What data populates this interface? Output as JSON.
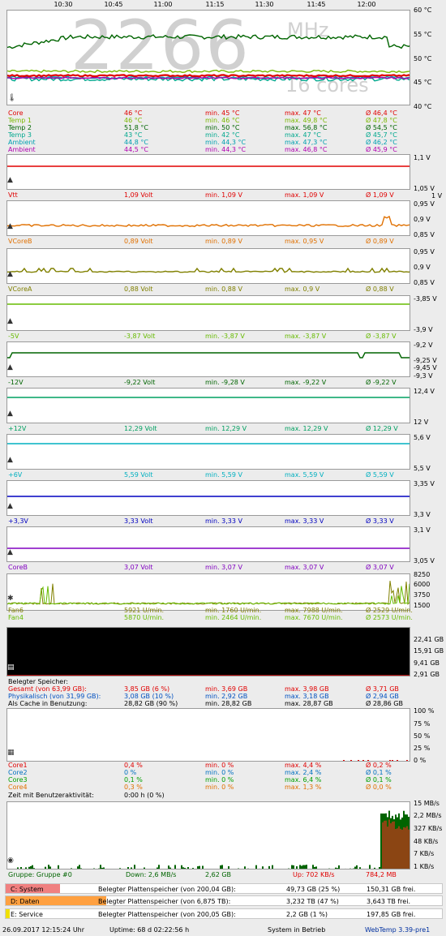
{
  "time_ticks": [
    "10:30",
    "10:45",
    "11:00",
    "11:15",
    "11:30",
    "11:45",
    "12:00"
  ],
  "temp": {
    "cpu_freq_value": "2266",
    "cpu_freq_unit": "MHz",
    "cores": "16 cores",
    "yaxis": [
      "60 °C",
      "55 °C",
      "50 °C",
      "45 °C",
      "40 °C"
    ],
    "rows": [
      {
        "name": "Core",
        "cur": "46 °C",
        "min": "min. 45 °C",
        "max": "max. 47 °C",
        "avg": "Ø 46,4 °C",
        "color": "#e00000"
      },
      {
        "name": "Temp 1",
        "cur": "46 °C",
        "min": "min. 46 °C",
        "max": "max. 49,8 °C",
        "avg": "Ø 47,8 °C",
        "color": "#7ab800"
      },
      {
        "name": "Temp 2",
        "cur": "51,8 °C",
        "min": "min. 50 °C",
        "max": "max. 56,8 °C",
        "avg": "Ø 54,5 °C",
        "color": "#006400"
      },
      {
        "name": "Temp 3",
        "cur": "43 °C",
        "min": "min. 42 °C",
        "max": "max. 47 °C",
        "avg": "Ø 45,7 °C",
        "color": "#00a88e"
      },
      {
        "name": "Ambient",
        "cur": "44,8 °C",
        "min": "min. 44,3 °C",
        "max": "max. 47,3 °C",
        "avg": "Ø 46,2 °C",
        "color": "#00a0b0"
      },
      {
        "name": "Ambient",
        "cur": "44,5 °C",
        "min": "min. 44,3 °C",
        "max": "max. 46,8 °C",
        "avg": "Ø 45,9 °C",
        "color": "#b000b0"
      }
    ]
  },
  "voltages": [
    {
      "name": "Vtt",
      "cur": "1,09 Volt",
      "min": "min. 1,09 V",
      "max": "max. 1,09 V",
      "avg": "Ø 1,09 V",
      "color": "#e00000",
      "ytop": "1,1 V",
      "ymid": "",
      "ybot": "1,05 V"
    },
    {
      "name": "VCoreB",
      "cur": "0,89 Volt",
      "min": "min. 0,89 V",
      "max": "max. 0,95 V",
      "avg": "Ø 0,89 V",
      "color": "#e07000",
      "ytop": "0,95 V",
      "ymid": "0,9 V",
      "ybot": "0,85 V",
      "ytop2": "1 V"
    },
    {
      "name": "VCoreA",
      "cur": "0,88 Volt",
      "min": "min. 0,88 V",
      "max": "max. 0,9 V",
      "avg": "Ø 0,88 V",
      "color": "#808000",
      "ytop": "0,95 V",
      "ymid": "0,9 V",
      "ybot": "0,85 V"
    },
    {
      "name": "-5V",
      "cur": "-3,87 Volt",
      "min": "min. -3,87 V",
      "max": "max. -3,87 V",
      "avg": "Ø -3,87 V",
      "color": "#66bb00",
      "ytop": "-3,85 V",
      "ymid": "",
      "ybot": "-3,9 V"
    },
    {
      "name": "-12V",
      "cur": "-9,22 Volt",
      "min": "min. -9,28 V",
      "max": "max. -9,22 V",
      "avg": "Ø -9,22 V",
      "color": "#006400",
      "ytop": "-9,2 V",
      "ymid": "-9,25 V",
      "ybot": "-9,3 V",
      "ytop0": "-9,45 V"
    },
    {
      "name": "+12V",
      "cur": "12,29 Volt",
      "min": "min. 12,29 V",
      "max": "max. 12,29 V",
      "avg": "Ø 12,29 V",
      "color": "#00a060",
      "ytop": "12,4 V",
      "ymid": "",
      "ybot": "12 V"
    },
    {
      "name": "+6V",
      "cur": "5,59 Volt",
      "min": "min. 5,59 V",
      "max": "max. 5,59 V",
      "avg": "Ø 5,59 V",
      "color": "#00b0c0",
      "ytop": "5,6 V",
      "ymid": "",
      "ybot": "5,5 V"
    },
    {
      "name": "+3,3V",
      "cur": "3,33 Volt",
      "min": "min. 3,33 V",
      "max": "max. 3,33 V",
      "avg": "Ø 3,33 V",
      "color": "#0000c0",
      "ytop": "3,35 V",
      "ymid": "",
      "ybot": "3,3 V"
    },
    {
      "name": "CoreB",
      "cur": "3,07 Volt",
      "min": "min. 3,07 V",
      "max": "max. 3,07 V",
      "avg": "Ø 3,07 V",
      "color": "#8000c0",
      "ytop": "3,1 V",
      "ymid": "",
      "ybot": "3,05 V"
    }
  ],
  "fans": {
    "yaxis": [
      "8250",
      "6000",
      "3750",
      "1500"
    ],
    "rows": [
      {
        "name": "Fan6",
        "cur": "5921 U/min.",
        "min": "min. 1760 U/min.",
        "max": "max. 7988 U/min.",
        "avg": "Ø 2529 U/min.",
        "color": "#808000"
      },
      {
        "name": "Fan4",
        "cur": "5870 U/min.",
        "min": "min. 2464 U/min.",
        "max": "max. 7670 U/min.",
        "avg": "Ø 2573 U/min.",
        "color": "#66bb00"
      }
    ]
  },
  "memory": {
    "yaxis": [
      "22,41 GB",
      "15,91 GB",
      "9,41 GB",
      "2,91 GB"
    ],
    "heading": "Belegter Speicher:",
    "rows": [
      {
        "name": "Gesamt (von 63,99 GB):",
        "cur": "3,85 GB (6 %)",
        "min": "min. 3,69 GB",
        "max": "max. 3,98 GB",
        "avg": "Ø 3,71 GB",
        "color": "#e00000"
      },
      {
        "name": "Physikalisch (von 31,99 GB):",
        "cur": "3,08 GB (10 %)",
        "min": "min. 2,92 GB",
        "max": "max. 3,18 GB",
        "avg": "Ø 2,94 GB",
        "color": "#0050c0"
      },
      {
        "name": "Als Cache in Benutzung:",
        "cur": "28,82 GB (90 %)",
        "min": "min. 28,82 GB",
        "max": "max. 28,87 GB",
        "avg": "Ø 28,86 GB",
        "color": "#000000"
      }
    ]
  },
  "cpu": {
    "yaxis": [
      "100 %",
      "75 %",
      "50 %",
      "25 %",
      "0 %"
    ],
    "rows": [
      {
        "name": "Core1",
        "cur": "0,4 %",
        "min": "min. 0 %",
        "max": "max. 4,4 %",
        "avg": "Ø 0,2 %",
        "color": "#e00000"
      },
      {
        "name": "Core2",
        "cur": "0 %",
        "min": "min. 0 %",
        "max": "max. 2,4 %",
        "avg": "Ø 0,1 %",
        "color": "#0070c0"
      },
      {
        "name": "Core3",
        "cur": "0,1 %",
        "min": "min. 0 %",
        "max": "max. 6,4 %",
        "avg": "Ø 0,1 %",
        "color": "#00a000"
      },
      {
        "name": "Core4",
        "cur": "0,3 %",
        "min": "min. 0 %",
        "max": "max. 1,3 %",
        "avg": "Ø 0,0 %",
        "color": "#e07000"
      }
    ],
    "user_activity_label": "Zeit mit Benutzeraktivität:",
    "user_activity_value": "0:00 h (0 %)"
  },
  "network": {
    "yaxis": [
      "15 MB/s",
      "2,2 MB/s",
      "327 KB/s",
      "48 KB/s",
      "7 KB/s",
      "1 KB/s"
    ],
    "group": "Gruppe: Gruppe #0",
    "down": "Down: 2,6 MB/s",
    "down_total": "2,62 GB",
    "up": "Up: 702 KB/s",
    "up_total": "784,2 MB"
  },
  "drives": [
    {
      "name": "C: System",
      "label": "Belegter Plattenspeicher (von 200,04 GB):",
      "used": "49,73 GB (25 %)",
      "free": "150,31 GB frei.",
      "color": "#f08080",
      "fill_pct": 25
    },
    {
      "name": "D: Daten",
      "label": "Belegter Plattenspeicher (von 6,875 TB):",
      "used": "3,232 TB (47 %)",
      "free": "3,643 TB frei.",
      "color": "#ffa040",
      "fill_pct": 47
    },
    {
      "name": "E: Service",
      "label": "Belegter Plattenspeicher (von 200,05 GB):",
      "used": "2,2 GB (1 %)",
      "free": "197,85 GB frei.",
      "color": "#f0e000",
      "fill_pct": 1
    }
  ],
  "footer": {
    "datetime": "26.09.2017 12:15:24 Uhr",
    "uptime": "Uptime: 68 d 02:22:56 h",
    "status": "System in Betrieb",
    "app": "WebTemp 3.39-pre1"
  },
  "colors": {
    "green": "#006400",
    "red": "#e00000",
    "blue": "#0000c0",
    "app_link": "#0030a0"
  }
}
